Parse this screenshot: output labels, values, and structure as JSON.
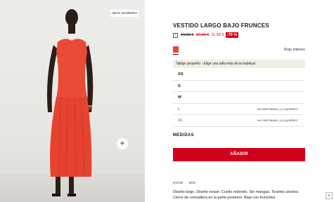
{
  "image": {
    "badge": "¡MÁS VENDIDO!",
    "zoom_icon": "+"
  },
  "product": {
    "title": "VESTIDO LARGO BAJO FRUNCES",
    "info_icon": "i",
    "price_original": "59,99 €",
    "price_previous": "27,99 €",
    "price_current": "11,99 €",
    "discount": "-70 %",
    "color_name": "Rojo intenso",
    "swatch_color": "#e8452f"
  },
  "fit_note": "Tallaje pequeño - Elige una talla más de la habitual",
  "sizes": [
    {
      "label": "XS",
      "status": ""
    },
    {
      "label": "S",
      "status": ""
    },
    {
      "label": "M",
      "status": ""
    },
    {
      "label": "L",
      "status": "NO DISPONIBLE ¿LO QUIERES?"
    },
    {
      "label": "XL",
      "status": "NO DISPONIBLE ¿LO QUIERES?"
    }
  ],
  "measures_label": "MEDIDAS",
  "add_button": "AÑADIR",
  "tags": [
    "EVASÉ",
    "MIDI"
  ],
  "description": "Diseño largo. Diseño evasé. Cuello redondo. Sin mangas. Tirantes anchos. Cierre de cremallera en la parte posterior. Bajo con fruncidos.",
  "side_icon": "≡",
  "colors": {
    "accent": "#d0021b",
    "dress": "#e8452f"
  }
}
